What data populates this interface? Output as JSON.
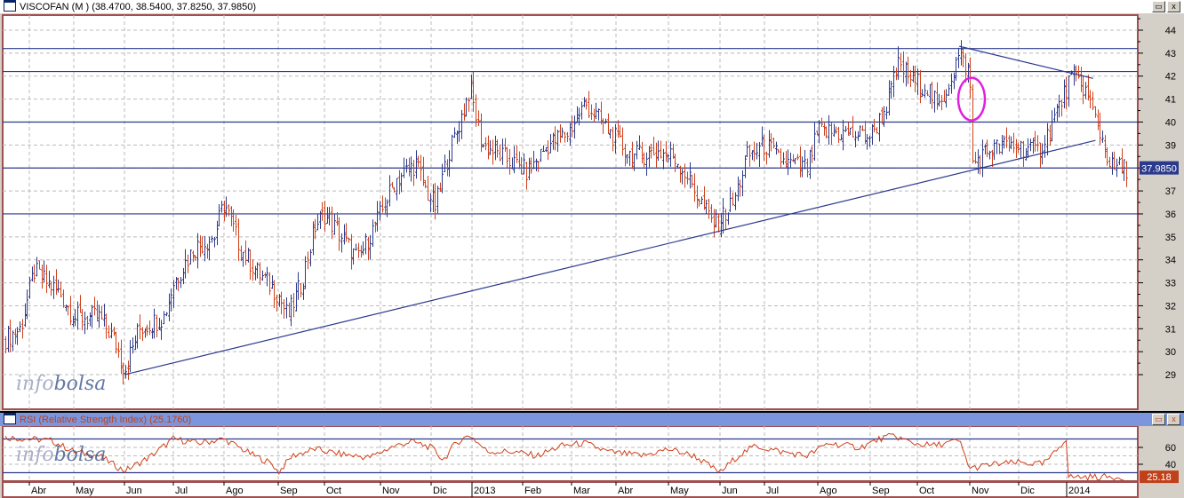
{
  "main_pane": {
    "title": "VISCOFAN (M ) (38.4700, 38.5400, 37.8250, 37.9850)",
    "last_price_label": "37.9850",
    "watermark_a": "info",
    "watermark_b": "bolsa"
  },
  "rsi_pane": {
    "title": "RSI (Relative Strength Index) (25.1760)",
    "last_value_label": "25.18",
    "watermark_a": "info",
    "watermark_b": "bolsa"
  },
  "window_buttons": {
    "restore": "▭",
    "close": "x"
  },
  "colors": {
    "up": "#2b3a8c",
    "down": "#d0401a",
    "rsi": "#d0401a",
    "line": "#2b3a8c",
    "ellipse": "#e020e0",
    "frame": "#a05050"
  },
  "chart_data": [
    {
      "type": "ohlc",
      "title": "VISCOFAN (M )",
      "ylim": [
        28,
        44.5
      ],
      "yticks": [
        29,
        30,
        31,
        32,
        33,
        34,
        35,
        36,
        37,
        38,
        39,
        40,
        41,
        42,
        43,
        44
      ],
      "x_labels": [
        "Abr",
        "May",
        "Jun",
        "Jul",
        "Ago",
        "Sep",
        "Oct",
        "Nov",
        "Dic",
        "2013",
        "Feb",
        "Mar",
        "Abr",
        "May",
        "Jun",
        "Jul",
        "Ago",
        "Sep",
        "Oct",
        "Nov",
        "Dic",
        "2014"
      ],
      "x_unit": "months since Apr 2012",
      "close_path": [
        [
          -0.6,
          30.5
        ],
        [
          -0.2,
          31
        ],
        [
          0.1,
          33.5
        ],
        [
          0.4,
          33
        ],
        [
          0.7,
          32.5
        ],
        [
          1.0,
          31.5
        ],
        [
          1.5,
          31.5
        ],
        [
          1.8,
          30.5
        ],
        [
          2.0,
          29.2
        ],
        [
          2.3,
          31
        ],
        [
          2.8,
          31.5
        ],
        [
          3.0,
          33
        ],
        [
          3.4,
          34.5
        ],
        [
          3.8,
          35
        ],
        [
          4.0,
          36.5
        ],
        [
          4.3,
          34.5
        ],
        [
          4.6,
          33.5
        ],
        [
          5.0,
          32.5
        ],
        [
          5.2,
          31.5
        ],
        [
          5.5,
          33
        ],
        [
          5.8,
          35.5
        ],
        [
          6.0,
          36
        ],
        [
          6.3,
          35
        ],
        [
          6.6,
          34
        ],
        [
          7.0,
          36
        ],
        [
          7.3,
          37.5
        ],
        [
          7.7,
          38.2
        ],
        [
          7.9,
          37
        ],
        [
          8.1,
          36.3
        ],
        [
          8.4,
          38.5
        ],
        [
          8.7,
          40
        ],
        [
          8.95,
          41.5
        ],
        [
          9.2,
          39
        ],
        [
          9.6,
          38.5
        ],
        [
          10.1,
          37.8
        ],
        [
          10.5,
          39
        ],
        [
          10.9,
          39.5
        ],
        [
          11.3,
          40.8
        ],
        [
          11.8,
          39.7
        ],
        [
          12.3,
          38.5
        ],
        [
          12.8,
          38.7
        ],
        [
          13.1,
          38.5
        ],
        [
          13.4,
          37.5
        ],
        [
          13.7,
          36.2
        ],
        [
          13.9,
          35.5
        ],
        [
          14.3,
          36.5
        ],
        [
          14.6,
          38.5
        ],
        [
          15.0,
          39
        ],
        [
          15.4,
          38.2
        ],
        [
          15.8,
          38
        ],
        [
          16.0,
          39.6
        ],
        [
          16.5,
          39.5
        ],
        [
          17.0,
          39.4
        ],
        [
          17.3,
          40.5
        ],
        [
          17.6,
          42.5
        ],
        [
          17.9,
          41.8
        ],
        [
          18.2,
          41.5
        ],
        [
          18.4,
          40.5
        ],
        [
          18.8,
          43
        ],
        [
          19.0,
          42
        ],
        [
          19.05,
          38.2
        ],
        [
          19.4,
          38.8
        ],
        [
          19.9,
          39
        ],
        [
          20.4,
          38.7
        ],
        [
          20.6,
          39.5
        ],
        [
          20.9,
          41
        ],
        [
          21.1,
          42
        ],
        [
          21.35,
          41.5
        ],
        [
          21.6,
          40
        ],
        [
          21.9,
          38
        ]
      ],
      "horizontal_lines": [
        43.2,
        42.2,
        40.0,
        38.0,
        36.0
      ],
      "trendlines": [
        [
          [
            2.0,
            29.0
          ],
          [
            21.6,
            39.2
          ]
        ],
        [
          [
            18.8,
            43.3
          ],
          [
            21.55,
            41.9
          ]
        ]
      ],
      "ellipse_marker": {
        "x": 19.0,
        "y": 41.0
      },
      "last": 37.985
    },
    {
      "type": "line",
      "title": "RSI (Relative Strength Index)",
      "ylim": [
        21,
        86
      ],
      "yticks": [
        40,
        60
      ],
      "levels": [
        30,
        70
      ],
      "points": [
        [
          -0.6,
          72
        ],
        [
          0,
          70
        ],
        [
          0.5,
          68
        ],
        [
          1.0,
          55
        ],
        [
          1.5,
          50
        ],
        [
          2.0,
          32
        ],
        [
          2.5,
          48
        ],
        [
          3.0,
          70
        ],
        [
          3.5,
          65
        ],
        [
          4.0,
          70
        ],
        [
          4.5,
          52
        ],
        [
          4.9,
          40
        ],
        [
          5.0,
          30
        ],
        [
          5.3,
          50
        ],
        [
          5.8,
          58
        ],
        [
          6.3,
          52
        ],
        [
          6.8,
          48
        ],
        [
          7.2,
          60
        ],
        [
          7.6,
          67
        ],
        [
          8.0,
          60
        ],
        [
          8.3,
          45
        ],
        [
          8.6,
          65
        ],
        [
          8.95,
          75
        ],
        [
          9.3,
          55
        ],
        [
          9.8,
          55
        ],
        [
          10.3,
          50
        ],
        [
          10.8,
          62
        ],
        [
          11.3,
          65
        ],
        [
          11.8,
          55
        ],
        [
          12.5,
          50
        ],
        [
          13.0,
          58
        ],
        [
          13.5,
          50
        ],
        [
          14.0,
          30
        ],
        [
          14.4,
          50
        ],
        [
          14.8,
          62
        ],
        [
          15.3,
          55
        ],
        [
          15.8,
          50
        ],
        [
          16.2,
          65
        ],
        [
          16.8,
          60
        ],
        [
          17.2,
          70
        ],
        [
          17.5,
          74
        ],
        [
          17.9,
          65
        ],
        [
          18.3,
          62
        ],
        [
          18.8,
          68
        ],
        [
          19.0,
          35
        ],
        [
          19.5,
          40
        ],
        [
          20.0,
          42
        ],
        [
          20.5,
          40
        ],
        [
          20.7,
          50
        ],
        [
          21.0,
          72
        ],
        [
          21.3,
          72
        ],
        [
          21.6,
          55
        ],
        [
          21.9,
          25
        ]
      ],
      "last": 25.176
    }
  ]
}
